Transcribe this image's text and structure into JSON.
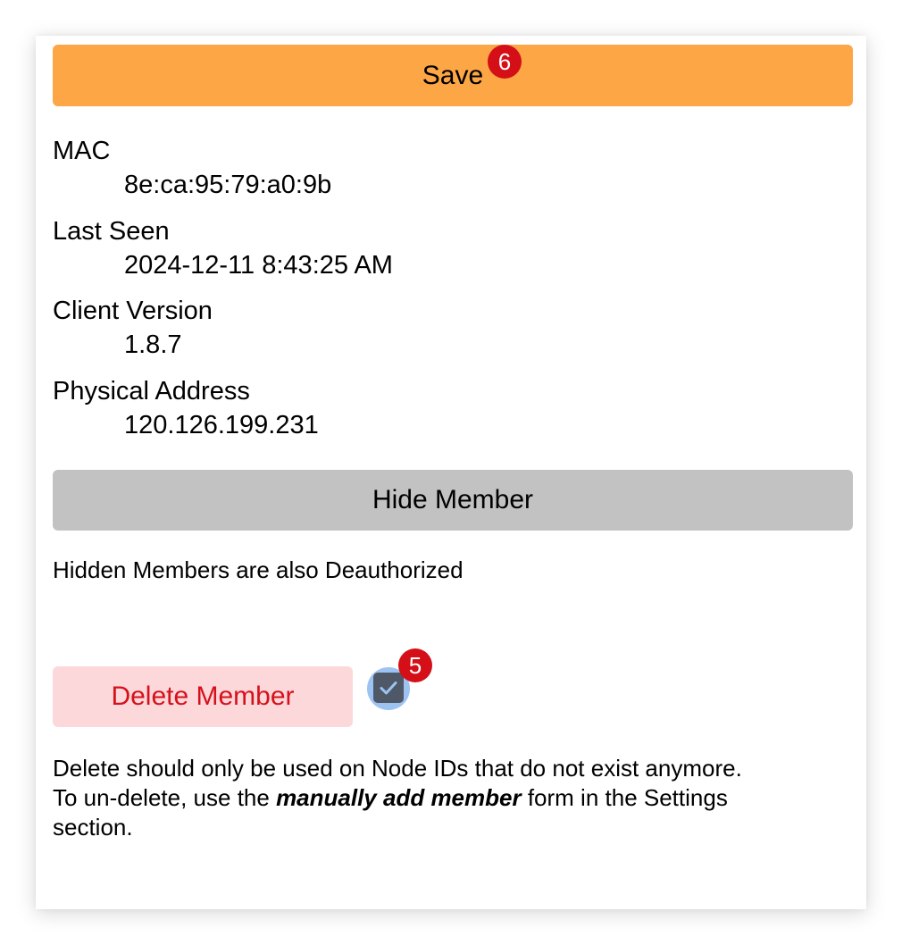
{
  "save_button": {
    "label": "Save",
    "badge": "6"
  },
  "fields": [
    {
      "label": "MAC",
      "value": "8e:ca:95:79:a0:9b"
    },
    {
      "label": "Last Seen",
      "value": "2024-12-11 8:43:25 AM"
    },
    {
      "label": "Client Version",
      "value": "1.8.7"
    },
    {
      "label": "Physical Address",
      "value": "120.126.199.231"
    }
  ],
  "hide_button": {
    "label": "Hide Member"
  },
  "hide_note": "Hidden Members are also Deauthorized",
  "delete_button": {
    "label": "Delete Member"
  },
  "delete_checkbox": {
    "checked": true,
    "badge": "5",
    "icon": "checkmark-icon"
  },
  "delete_note": {
    "line1": "Delete should only be used on Node IDs that do not exist anymore.",
    "line2_prefix": "To un-delete, use the ",
    "line2_emphasis": "manually add member",
    "line2_suffix": " form in the Settings",
    "line3": "section."
  },
  "colors": {
    "save": "#fca646",
    "hide": "#c2c2c2",
    "delete_bg": "#fdd8da",
    "delete_text": "#d6111c",
    "badge": "#d40f17",
    "checkbox": "#4f5866",
    "checkbox_focus": "#9cc3f2"
  }
}
